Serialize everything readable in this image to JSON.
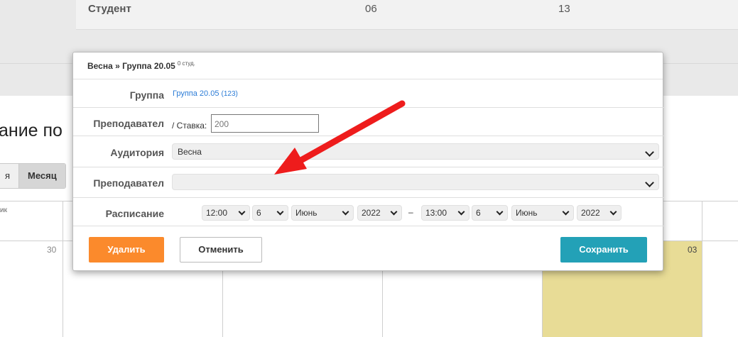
{
  "background": {
    "header_student": "Студент",
    "col_06": "06",
    "col_13": "13",
    "heading_fragment": "ание по",
    "view_buttons": [
      "я",
      "Месяц"
    ],
    "day_name_fragment": "ик",
    "date_30": "30",
    "date_03": "03",
    "highlight_color": "#e8dc96"
  },
  "modal": {
    "title": "Весна » Группа 20.05",
    "title_count": "0 студ.",
    "rows": {
      "group_label": "Группа",
      "group_link_name": "Группа 20.05",
      "group_link_num": "(123)",
      "teacher_label": "Преподавател",
      "rate_label": "/ Ставка:",
      "rate_value": "200",
      "room_label": "Аудитория",
      "room_value": "Весна",
      "teacher2_label": "Преподавател",
      "teacher2_value": "",
      "schedule_label": "Расписание"
    },
    "schedule": {
      "start_time": "12:00",
      "start_day": "6",
      "start_month": "Июнь",
      "start_year": "2022",
      "separator": "–",
      "end_time": "13:00",
      "end_day": "6",
      "end_month": "Июнь",
      "end_year": "2022"
    },
    "buttons": {
      "delete": "Удалить",
      "cancel": "Отменить",
      "save": "Сохранить"
    }
  },
  "colors": {
    "delete": "#fb8a2c",
    "save": "#23a1b7",
    "link": "#2a7bd6",
    "arrow": "#ee1c1c"
  }
}
